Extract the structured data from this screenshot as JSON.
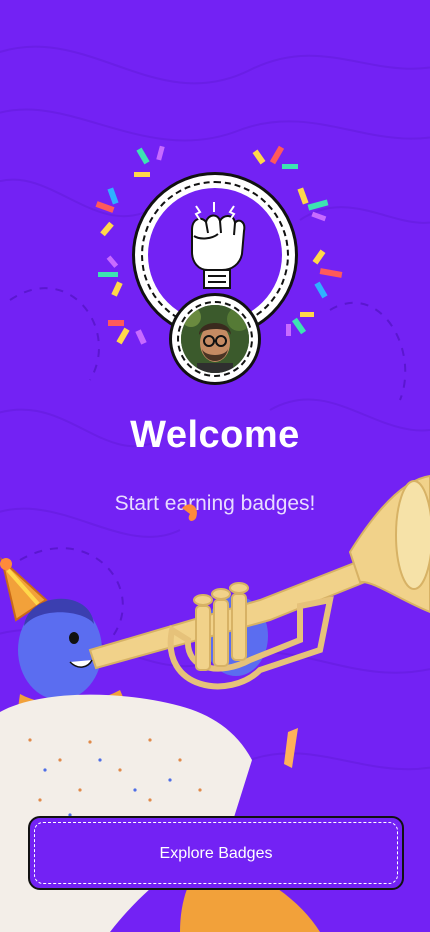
{
  "welcome": {
    "title": "Welcome",
    "subtitle": "Start earning badges!",
    "cta_label": "Explore Badges"
  },
  "icons": {
    "badge": "raised-fist-icon",
    "avatar": "profile-avatar"
  },
  "colors": {
    "background": "#7322f4",
    "text": "#ffffff",
    "subtitle_text": "#e8dcff",
    "button_border": "#111111"
  }
}
